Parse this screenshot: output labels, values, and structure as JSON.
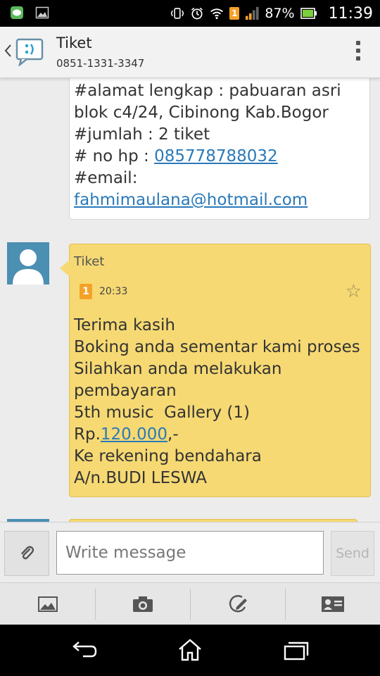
{
  "status_bar": {
    "battery_percent": "87%",
    "clock": "11:39",
    "sim_badge": "1",
    "icons": [
      "line-app-icon",
      "gallery-notification-icon",
      "vibrate-icon",
      "alarm-icon",
      "wifi-icon",
      "sim-1-icon",
      "signal-icon",
      "battery-icon"
    ]
  },
  "header": {
    "title": "Tiket",
    "phone": "0851-1331-3347",
    "icons": [
      "back-chevron-icon",
      "messaging-app-icon",
      "overflow-menu-icon"
    ]
  },
  "messages": [
    {
      "direction": "outgoing",
      "lines": [
        {
          "text": "#alamat lengkap : pabuaran asri"
        },
        {
          "text": "blok c4/24, Cibinong Kab.Bogor"
        },
        {
          "text": "#jumlah : 2 tiket"
        },
        {
          "prefix": "# no hp : ",
          "link": "085778788032"
        },
        {
          "text": "#email:"
        },
        {
          "link": "fahmimaulana@hotmail.com"
        }
      ]
    },
    {
      "direction": "incoming",
      "sender": "Tiket",
      "sim_badge": "1",
      "time": "20:33",
      "lines": [
        {
          "text": "Terima kasih"
        },
        {
          "text": "Boking anda sementar kami proses"
        },
        {
          "text": "Silahkan anda melakukan"
        },
        {
          "text": "pembayaran"
        },
        {
          "text": "5th music  Gallery (1)"
        },
        {
          "prefix": "Rp.",
          "link": "120.000",
          "suffix": ",-"
        },
        {
          "text": "Ke rekening bendahara"
        },
        {
          "text": "A/n.BUDI LESWA"
        }
      ]
    }
  ],
  "compose": {
    "placeholder": "Write message",
    "value": "",
    "send_label": "Send"
  },
  "attach_bar": {
    "items": [
      "picture-icon",
      "camera-icon",
      "sketch-icon",
      "contact-card-icon"
    ]
  },
  "nav_bar": {
    "items": [
      "back-icon",
      "home-icon",
      "recent-apps-icon"
    ]
  },
  "colors": {
    "incoming_bubble": "#f6d973",
    "link": "#2a79b8",
    "avatar_bg": "#4b8fb3"
  }
}
